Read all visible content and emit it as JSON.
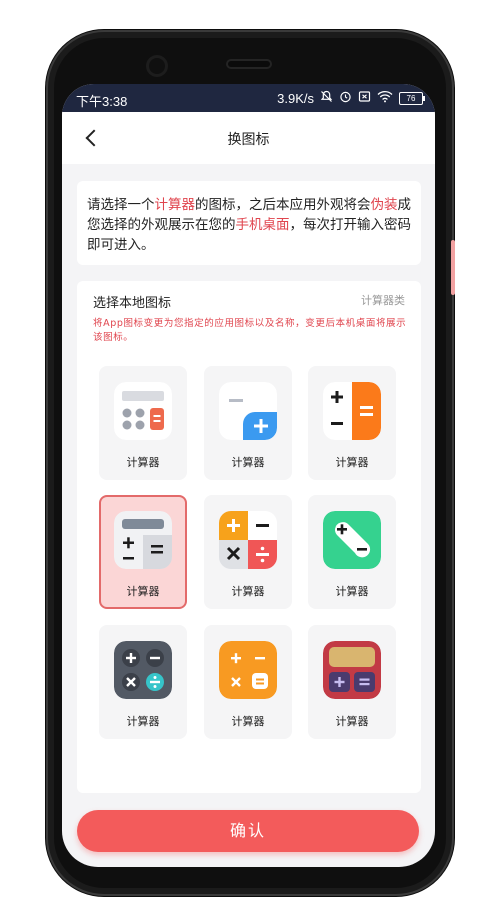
{
  "status_bar": {
    "time": "下午3:38",
    "network_speed": "3.9K/s",
    "icons": [
      "mute-icon",
      "alarm-icon",
      "sim-x-icon",
      "wifi-icon",
      "battery-icon"
    ],
    "battery": "76"
  },
  "header": {
    "title": "换图标",
    "back_icon": "chevron-left-icon"
  },
  "intro": {
    "t1": "请选择一个",
    "h1": "计算器",
    "t2": "的图标，之后本应用外观将会",
    "h2": "伪装",
    "t3": "成您选择的外观展示在您的",
    "h3": "手机桌面",
    "t4": "，每次打开输入密码即可进入。"
  },
  "panel": {
    "title": "选择本地图标",
    "category": "计算器类",
    "note": "将App图标变更为您指定的应用图标以及名称，变更后本机桌面将展示该图标。",
    "selected_index": 3,
    "icons": [
      {
        "label": "计算器",
        "icon": "calculator-grid-icon"
      },
      {
        "label": "计算器",
        "icon": "calculator-minus-plus-icon"
      },
      {
        "label": "计算器",
        "icon": "calculator-orange-equals-icon"
      },
      {
        "label": "计算器",
        "icon": "calculator-gray-display-icon"
      },
      {
        "label": "计算器",
        "icon": "calculator-four-color-icon"
      },
      {
        "label": "计算器",
        "icon": "calculator-green-bubble-icon"
      },
      {
        "label": "计算器",
        "icon": "calculator-dark-round-icon"
      },
      {
        "label": "计算器",
        "icon": "calculator-orange-icon"
      },
      {
        "label": "计算器",
        "icon": "calculator-retro-red-icon"
      }
    ]
  },
  "confirm_label": "确认",
  "colors": {
    "accent": "#f35b5b",
    "status_bar": "#1f2740",
    "highlight_text": "#e0454e"
  }
}
